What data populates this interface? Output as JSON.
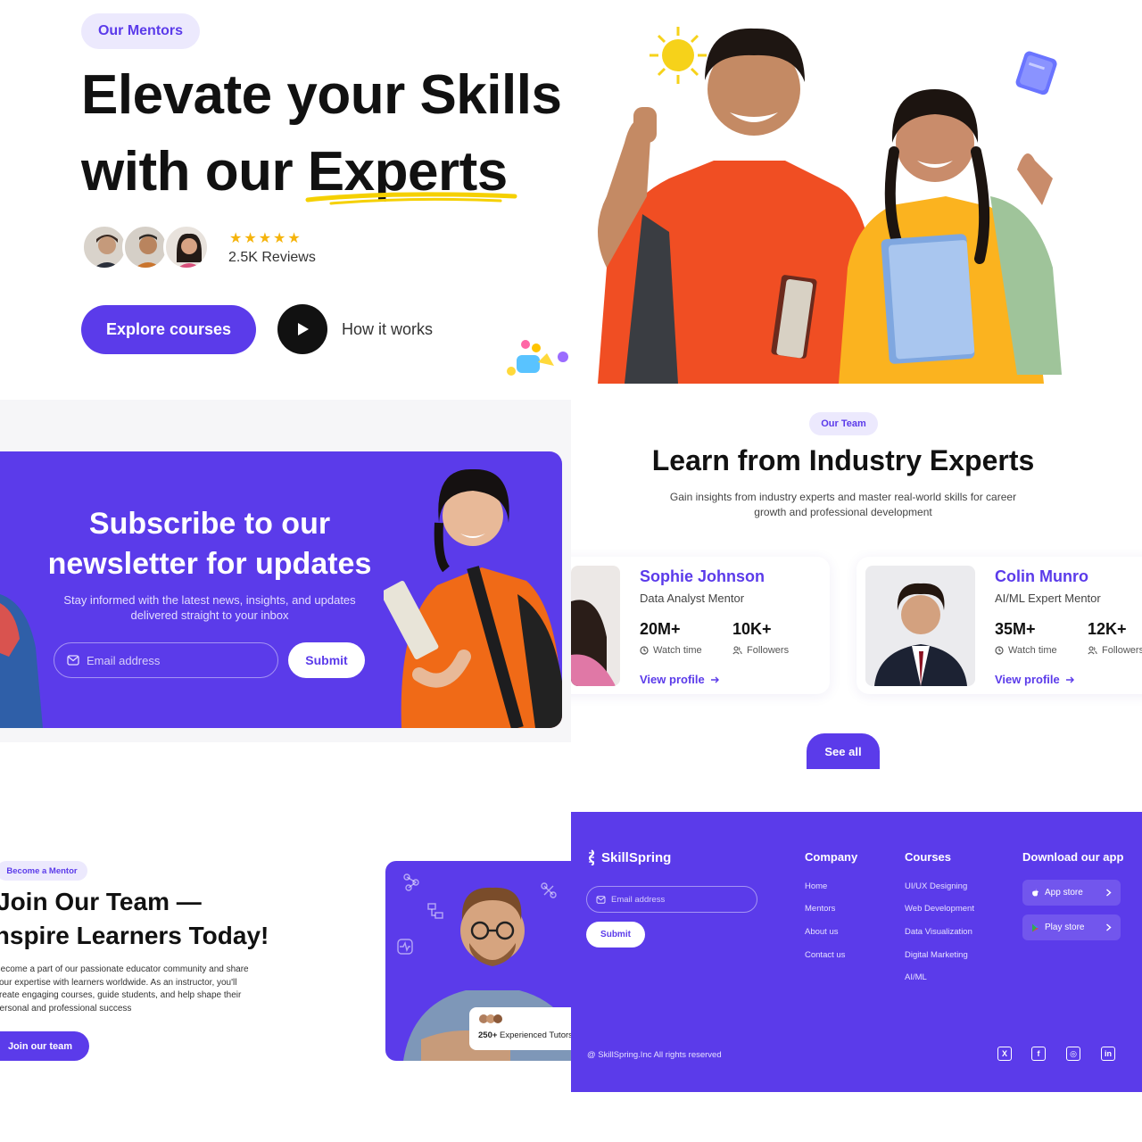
{
  "hero": {
    "badge": "Our Mentors",
    "title_line1": "Elevate your Skills",
    "title_line2_prefix": "with our ",
    "title_line2_highlight": "Experts",
    "rating_stars": "★★★★★",
    "reviews": "2.5K Reviews",
    "explore_label": "Explore courses",
    "how_label": "How it works"
  },
  "newsletter": {
    "title_line1": "Subscribe to our",
    "title_line2": "newsletter for updates",
    "subtitle_line1": "Stay informed with the latest news, insights, and updates",
    "subtitle_line2": "delivered straight to your inbox",
    "email_placeholder": "Email address",
    "submit_label": "Submit"
  },
  "team": {
    "badge": "Our Team",
    "title": "Learn from Industry Experts",
    "subtitle_line1": "Gain insights from industry experts and master real-world skills for career",
    "subtitle_line2": "growth and professional development",
    "see_all": "See all",
    "mentors": [
      {
        "name": "Sophie Johnson",
        "role": "Data Analyst Mentor",
        "watch": "20M+",
        "watch_label": "Watch time",
        "followers": "10K+",
        "followers_label": "Followers",
        "link": "View profile"
      },
      {
        "name": "Colin Munro",
        "role": "AI/ML Expert Mentor",
        "watch": "35M+",
        "watch_label": "Watch time",
        "followers": "12K+",
        "followers_label": "Followers",
        "link": "View profile"
      }
    ]
  },
  "join": {
    "badge": "Become a Mentor",
    "title_line1": "Join Our Team —",
    "title_line2": "Inspire Learners Today!",
    "body_line1": "Become a part of our passionate educator community and share",
    "body_line2": "your expertise with learners worldwide. As an instructor, you'll",
    "body_line3": "create engaging courses, guide students, and help shape their",
    "body_line4": "personal and professional success",
    "button": "Join our team",
    "tutors_count": "250+",
    "tutors_label": "Experienced Tutors"
  },
  "footer": {
    "brand": "SkillSpring",
    "email_placeholder": "Email address",
    "submit_label": "Submit",
    "company_head": "Company",
    "company_links": [
      "Home",
      "Mentors",
      "About us",
      "Contact us"
    ],
    "courses_head": "Courses",
    "course_links": [
      "UI/UX Designing",
      "Web Development",
      "Data Visualization",
      "Digital Marketing",
      "AI/ML"
    ],
    "download_head": "Download our app",
    "app_store": "App store",
    "play_store": "Play store",
    "copyright": "@ SkillSpring.Inc All rights reserved",
    "social_x": "X",
    "social_fb": "f",
    "social_ig": "◎",
    "social_in": "in"
  },
  "colors": {
    "brand": "#5b3bea",
    "badge_bg": "#ece9fd",
    "accent_yellow": "#f5d000",
    "shirt_orange": "#f04e23"
  }
}
